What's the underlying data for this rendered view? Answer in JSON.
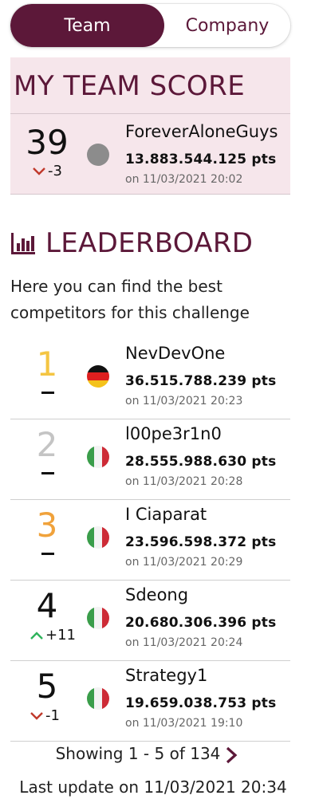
{
  "toggle": {
    "team_label": "Team",
    "company_label": "Company"
  },
  "my_score": {
    "title": "MY TEAM SCORE",
    "rank": "39",
    "delta": "-3",
    "team": "ForeverAloneGuys",
    "points": "13.883.544.125 pts",
    "timestamp": "on 11/03/2021 20:02"
  },
  "leaderboard": {
    "title": "LEADERBOARD",
    "description": "Here you can find the best competitors for this challenge",
    "rows": [
      {
        "rank": "1",
        "rank_color": "#f4c542",
        "change": "",
        "change_dir": "none",
        "flag": "germany",
        "team": "NevDevOne",
        "points": "36.515.788.239 pts",
        "timestamp": "on 11/03/2021 20:23"
      },
      {
        "rank": "2",
        "rank_color": "#c4c4c4",
        "change": "",
        "change_dir": "none",
        "flag": "italy",
        "team": "l00pe3r1n0",
        "points": "28.555.988.630 pts",
        "timestamp": "on 11/03/2021 20:28"
      },
      {
        "rank": "3",
        "rank_color": "#f0a23b",
        "change": "",
        "change_dir": "none",
        "flag": "italy",
        "team": "I Ciaparat",
        "points": "23.596.598.372 pts",
        "timestamp": "on 11/03/2021 20:29"
      },
      {
        "rank": "4",
        "rank_color": "#111111",
        "change": "+11",
        "change_dir": "up",
        "flag": "italy",
        "team": "Sdeong",
        "points": "20.680.306.396 pts",
        "timestamp": "on 11/03/2021 20:24"
      },
      {
        "rank": "5",
        "rank_color": "#111111",
        "change": "-1",
        "change_dir": "down",
        "flag": "italy",
        "team": "Strategy1",
        "points": "19.659.038.753 pts",
        "timestamp": "on 11/03/2021 19:10"
      }
    ]
  },
  "pagination": {
    "text": "Showing 1 - 5 of 134",
    "next_icon": "chevron-right-icon"
  },
  "last_update": "Last update on 11/03/2021 20:34",
  "colors": {
    "brand": "#5c1839",
    "panel": "#f6e6eb",
    "up": "#2fb35c",
    "down": "#c0392b"
  }
}
